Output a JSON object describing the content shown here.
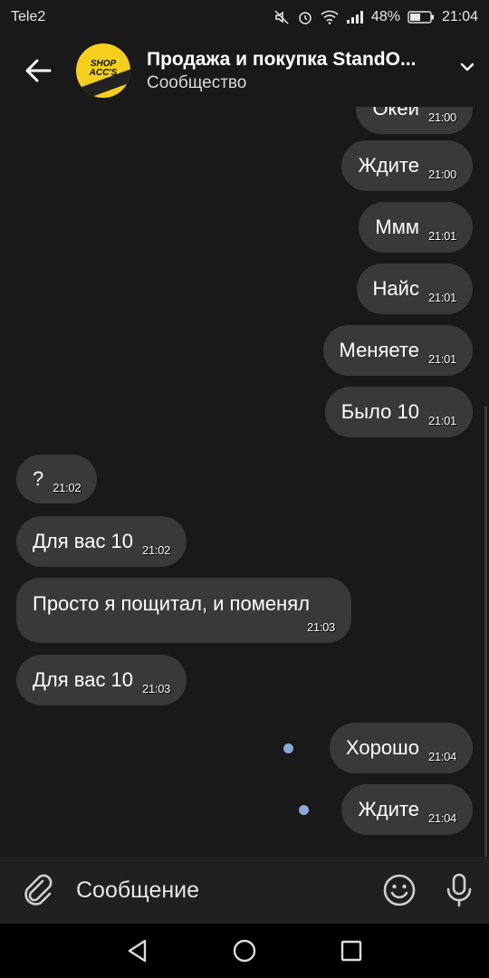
{
  "status": {
    "carrier": "Tele2",
    "battery": "48%",
    "time": "21:04"
  },
  "header": {
    "title": "Продажа и покупка StandO...",
    "subtitle": "Сообщество",
    "avatar_text": "SHOP ACC'S"
  },
  "messages": [
    {
      "text": "Окей",
      "time": "21:00",
      "side": "out"
    },
    {
      "text": "Ждите",
      "time": "21:00",
      "side": "out"
    },
    {
      "text": "Ммм",
      "time": "21:01",
      "side": "out"
    },
    {
      "text": "Найс",
      "time": "21:01",
      "side": "out"
    },
    {
      "text": "Меняете",
      "time": "21:01",
      "side": "out"
    },
    {
      "text": "Было 10",
      "time": "21:01",
      "side": "out"
    },
    {
      "text": "?",
      "time": "21:02",
      "side": "in"
    },
    {
      "text": "Для вас 10",
      "time": "21:02",
      "side": "in"
    },
    {
      "text": "Просто я пощитал, и поменял",
      "time": "21:03",
      "side": "in"
    },
    {
      "text": "Для вас 10",
      "time": "21:03",
      "side": "in"
    },
    {
      "text": "Хорошо",
      "time": "21:04",
      "side": "out",
      "unread": true
    },
    {
      "text": "Ждите",
      "time": "21:04",
      "side": "out",
      "unread": true
    }
  ],
  "composer": {
    "placeholder": "Сообщение"
  },
  "colors": {
    "background": "#191919",
    "bubble": "#393939",
    "unread_dot": "#8aa9d6"
  }
}
